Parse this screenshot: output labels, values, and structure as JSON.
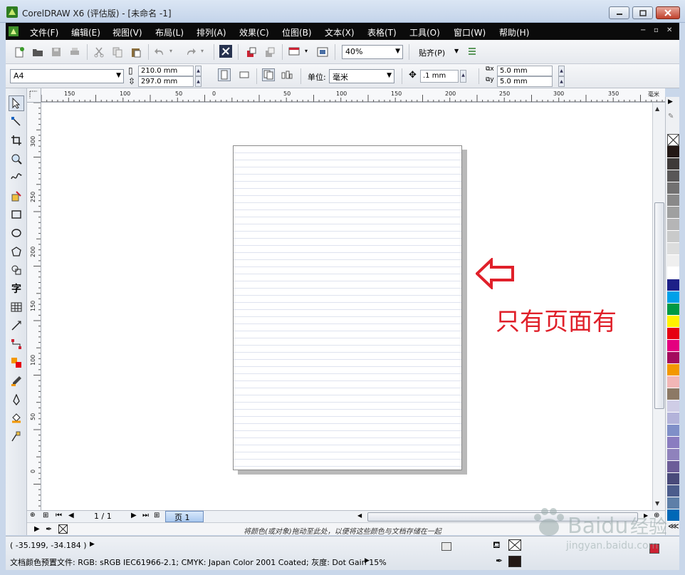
{
  "window": {
    "title": "CorelDRAW X6 (评估版) - [未命名 -1]"
  },
  "menu": [
    {
      "label": "文件(F)"
    },
    {
      "label": "编辑(E)"
    },
    {
      "label": "视图(V)"
    },
    {
      "label": "布局(L)"
    },
    {
      "label": "排列(A)"
    },
    {
      "label": "效果(C)"
    },
    {
      "label": "位图(B)"
    },
    {
      "label": "文本(X)"
    },
    {
      "label": "表格(T)"
    },
    {
      "label": "工具(O)"
    },
    {
      "label": "窗口(W)"
    },
    {
      "label": "帮助(H)"
    }
  ],
  "toolbar": {
    "zoom": "40%",
    "snap": "贴齐(P)"
  },
  "property_bar": {
    "page_size": "A4",
    "width": "210.0 mm",
    "height": "297.0 mm",
    "units_label": "单位:",
    "units": "毫米",
    "nudge": ".1 mm",
    "dup_x": "5.0 mm",
    "dup_y": "5.0 mm"
  },
  "ruler": {
    "h_labels": [
      "150",
      "100",
      "50",
      "0",
      "50",
      "100",
      "150",
      "200",
      "250",
      "300",
      "350"
    ],
    "unit": "毫米",
    "v_labels": [
      "300",
      "250",
      "200",
      "150",
      "100",
      "50",
      "0"
    ]
  },
  "annotation": {
    "text": "只有页面有",
    "color": "#e0202a"
  },
  "doc_nav": {
    "page_count": "1 / 1",
    "page_tab": "页 1"
  },
  "color_hint": "将颜色(或对象)拖动至此处，以便将这些颜色与文档存储在一起",
  "status": {
    "coords": "( -35.199, -34.184 )",
    "profile": "文档颜色预置文件: RGB: sRGB IEC61966-2.1; CMYK: Japan Color 2001 Coated; 灰度: Dot Gain 15%"
  },
  "palette": [
    "#231815",
    "#3e3a39",
    "#595757",
    "#727171",
    "#898989",
    "#9fa0a0",
    "#b5b5b6",
    "#c9caca",
    "#dcdddd",
    "#efefef",
    "#ffffff",
    "#1d2088",
    "#00a0e9",
    "#009944",
    "#fff100",
    "#e60012",
    "#e4007f",
    "#a40b5d",
    "#f39800",
    "#f2b6b6",
    "#8c7965",
    "#cfcde6",
    "#b3b3da",
    "#7f8fc8",
    "#8a7cc0",
    "#8f82bc",
    "#6c5d98",
    "#494a7a",
    "#4b5c8c",
    "#5e7fa8",
    "#0068b7"
  ]
}
